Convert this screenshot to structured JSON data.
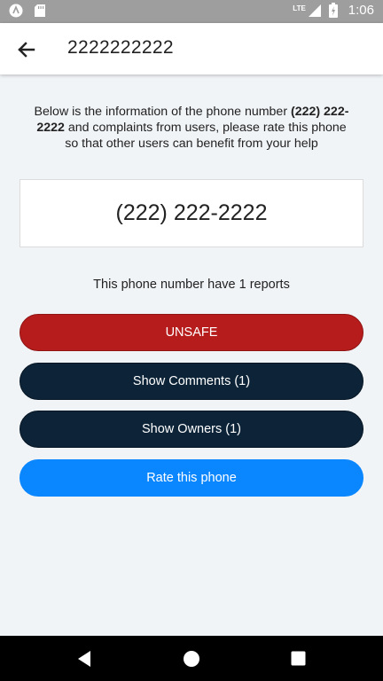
{
  "status_bar": {
    "time": "1:06",
    "network_label": "LTE",
    "icons": [
      "app-icon",
      "sd-card-icon",
      "signal-icon",
      "battery-charging-icon"
    ]
  },
  "app_bar": {
    "title": "2222222222",
    "back_icon": "arrow-back-icon"
  },
  "intro": {
    "part1": "Below is the information of the phone number ",
    "number_bold": "(222) 222-2222",
    "part2": " and complaints from users, please rate this phone so that other users can benefit from your help"
  },
  "phone_display": "(222) 222-2222",
  "reports_text": "This phone number have 1 reports",
  "buttons": {
    "unsafe": "UNSAFE",
    "comments": "Show Comments (1)",
    "owners": "Show Owners (1)",
    "rate": "Rate this phone"
  },
  "colors": {
    "unsafe": "#b71c1c",
    "dark_button": "#0d2438",
    "rate_button": "#0a86ff",
    "background": "#f1f4f7"
  },
  "nav_bar": {
    "icons": [
      "nav-back-icon",
      "nav-home-icon",
      "nav-recents-icon"
    ]
  }
}
